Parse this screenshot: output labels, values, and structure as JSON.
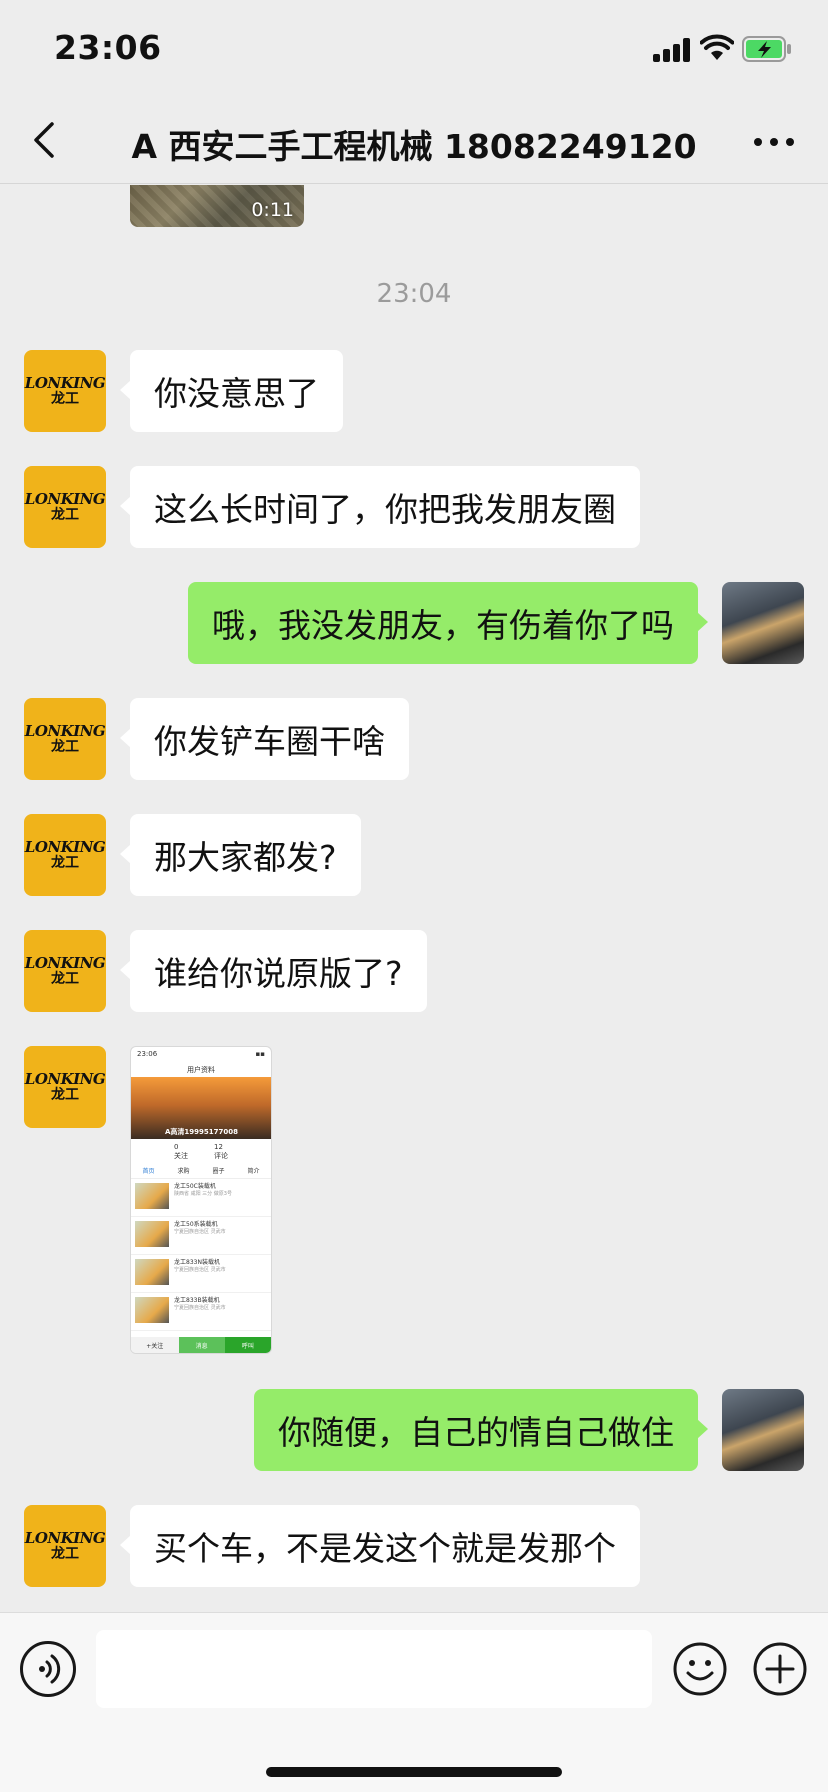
{
  "status_bar": {
    "time": "23:06"
  },
  "nav": {
    "title": "A 西安二手工程机械 18082249120"
  },
  "chat": {
    "video_duration": "0:11",
    "timestamp": "23:04",
    "messages": [
      {
        "side": "left",
        "text": "你没意思了"
      },
      {
        "side": "left",
        "text": "这么长时间了，你把我发朋友圈"
      },
      {
        "side": "right",
        "text": "哦，我没发朋友，有伤着你了吗"
      },
      {
        "side": "left",
        "text": "你发铲车圈干啥"
      },
      {
        "side": "left",
        "text": "那大家都发?"
      },
      {
        "side": "left",
        "text": "谁给你说原版了?"
      },
      {
        "side": "left",
        "type": "image"
      },
      {
        "side": "right",
        "text": "你随便，自己的情自己做住"
      },
      {
        "side": "left",
        "text": "买个车，不是发这个就是发那个"
      }
    ],
    "avatar_brand": {
      "line1": "LONKING",
      "line2": "龙工"
    }
  },
  "shared_screenshot": {
    "time": "23:06",
    "title": "用户资料",
    "name": "A高清19995177008",
    "stats": [
      {
        "value": "0",
        "label": "关注"
      },
      {
        "value": "12",
        "label": "评论"
      }
    ],
    "tabs": [
      "首页",
      "求购",
      "圈子",
      "简介"
    ],
    "items": [
      {
        "title": "龙工50C装载机",
        "sub": "陕西省 咸阳 三分 做原3号"
      },
      {
        "title": "龙工50系装载机",
        "sub": "宁夏回族自治区 灵武市"
      },
      {
        "title": "龙工833N装载机",
        "sub": "宁夏回族自治区 灵武市"
      },
      {
        "title": "龙工833B装载机",
        "sub": "宁夏回族自治区 灵武市"
      }
    ],
    "bottom": [
      "+关注",
      "消息",
      "呼叫"
    ]
  },
  "input_bar": {
    "placeholder": ""
  },
  "colors": {
    "sent_bubble": "#95ec69",
    "received_bubble": "#ffffff",
    "background": "#ededed",
    "brand_yellow": "#f0b31a"
  }
}
